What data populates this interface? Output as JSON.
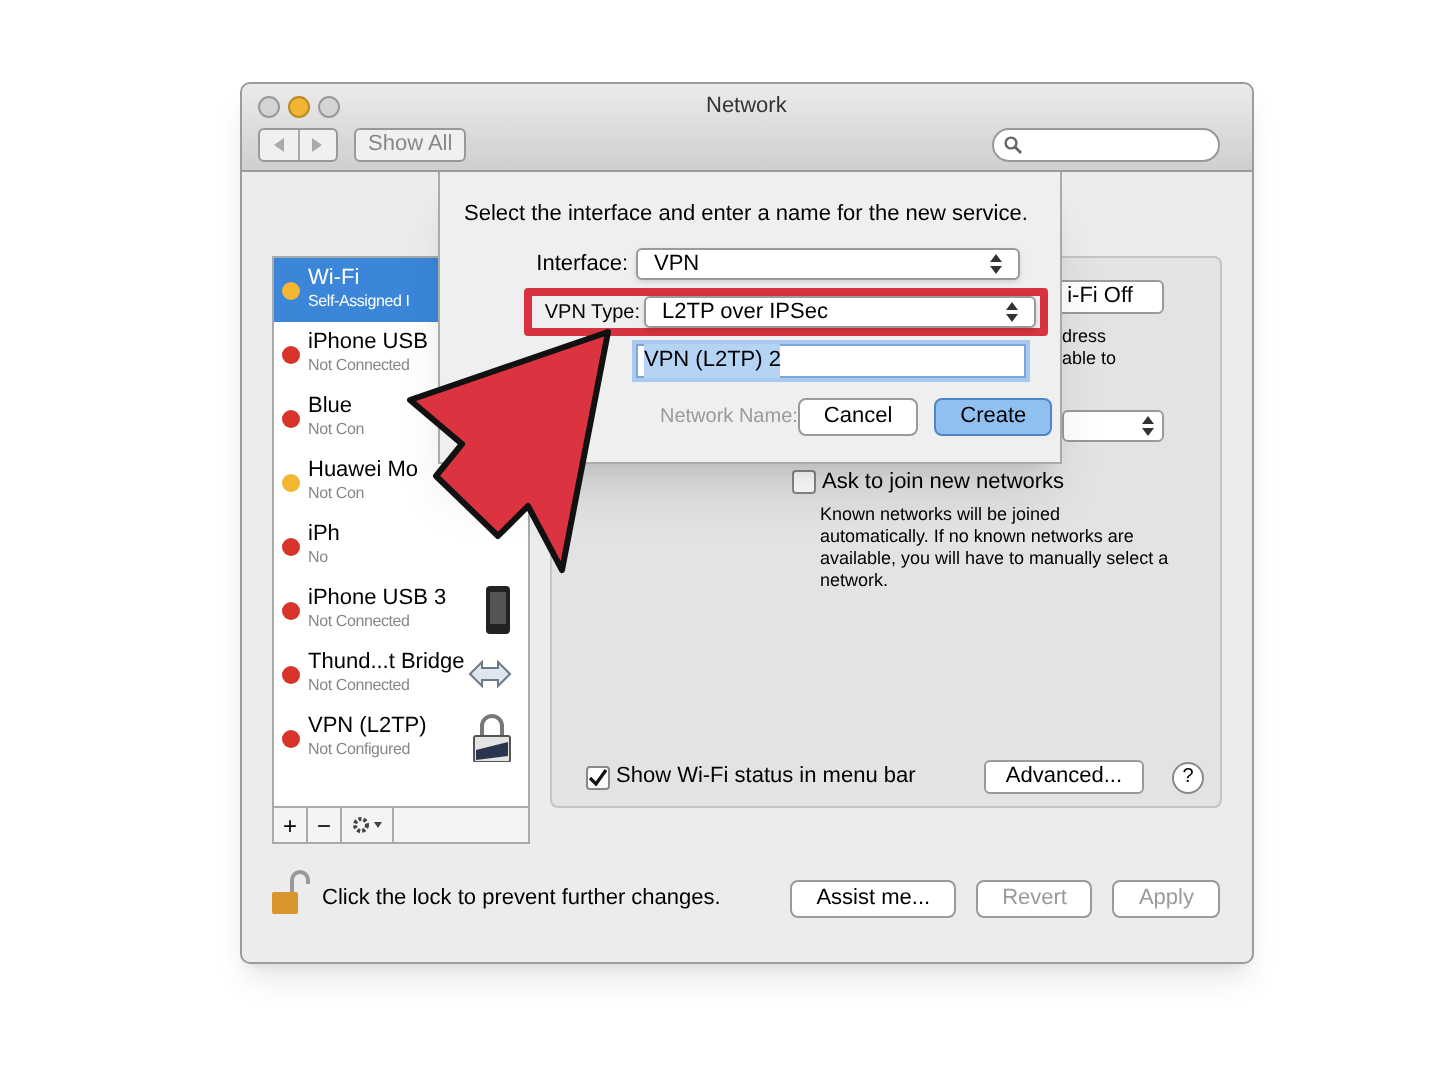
{
  "window": {
    "title": "Network"
  },
  "toolbar": {
    "show_all": "Show All"
  },
  "sidebar": {
    "items": [
      {
        "name": "Wi-Fi",
        "status": "Self-Assigned I",
        "color": "#f2b632",
        "selected": true
      },
      {
        "name": "iPhone USB",
        "status": "Not Connected",
        "color": "#d8342c",
        "selected": false
      },
      {
        "name": "Blue",
        "status": "Not Con",
        "color": "#d8342c",
        "selected": false
      },
      {
        "name": "Huawei Mo",
        "status": "Not Con",
        "color": "#f2b632",
        "selected": false
      },
      {
        "name": "iPh",
        "status": "No",
        "color": "#d8342c",
        "selected": false
      },
      {
        "name": "iPhone USB 3",
        "status": "Not Connected",
        "color": "#d8342c",
        "selected": false,
        "kind": "phone"
      },
      {
        "name": "Thund...t Bridge",
        "status": "Not Connected",
        "color": "#d8342c",
        "selected": false,
        "kind": "bridge"
      },
      {
        "name": "VPN (L2TP)",
        "status": "Not Configured",
        "color": "#d8342c",
        "selected": false,
        "kind": "vpn"
      }
    ],
    "add": "+",
    "remove": "−"
  },
  "pane": {
    "wifi_button": "i-Fi Off",
    "status_lines": [
      "dress",
      "able to"
    ],
    "ask_to_join": {
      "label": "Ask to join new networks",
      "checked": false
    },
    "ask_note": "Known networks will be joined automatically. If no known networks are available, you will have to manually select a network.",
    "show_status": {
      "label": "Show Wi-Fi status in menu bar",
      "checked": true
    },
    "advanced": "Advanced...",
    "help": "?"
  },
  "footer": {
    "lock_text": "Click the lock to prevent further changes.",
    "buttons": [
      {
        "label": "Assist me...",
        "disabled": false
      },
      {
        "label": "Revert",
        "disabled": true
      },
      {
        "label": "Apply",
        "disabled": true
      }
    ]
  },
  "dialog": {
    "prompt": "Select the interface and enter a name for the new service.",
    "interface": {
      "label": "Interface:",
      "value": "VPN"
    },
    "vpn_type": {
      "label": "VPN Type:",
      "value": "L2TP over IPSec",
      "highlighted": true
    },
    "service_name": {
      "value": "VPN (L2TP) 2"
    },
    "network_name": {
      "label": "Network Name:",
      "disabled": true
    },
    "buttons": [
      {
        "label": "Cancel",
        "default": false
      },
      {
        "label": "Create",
        "default": true
      }
    ]
  }
}
